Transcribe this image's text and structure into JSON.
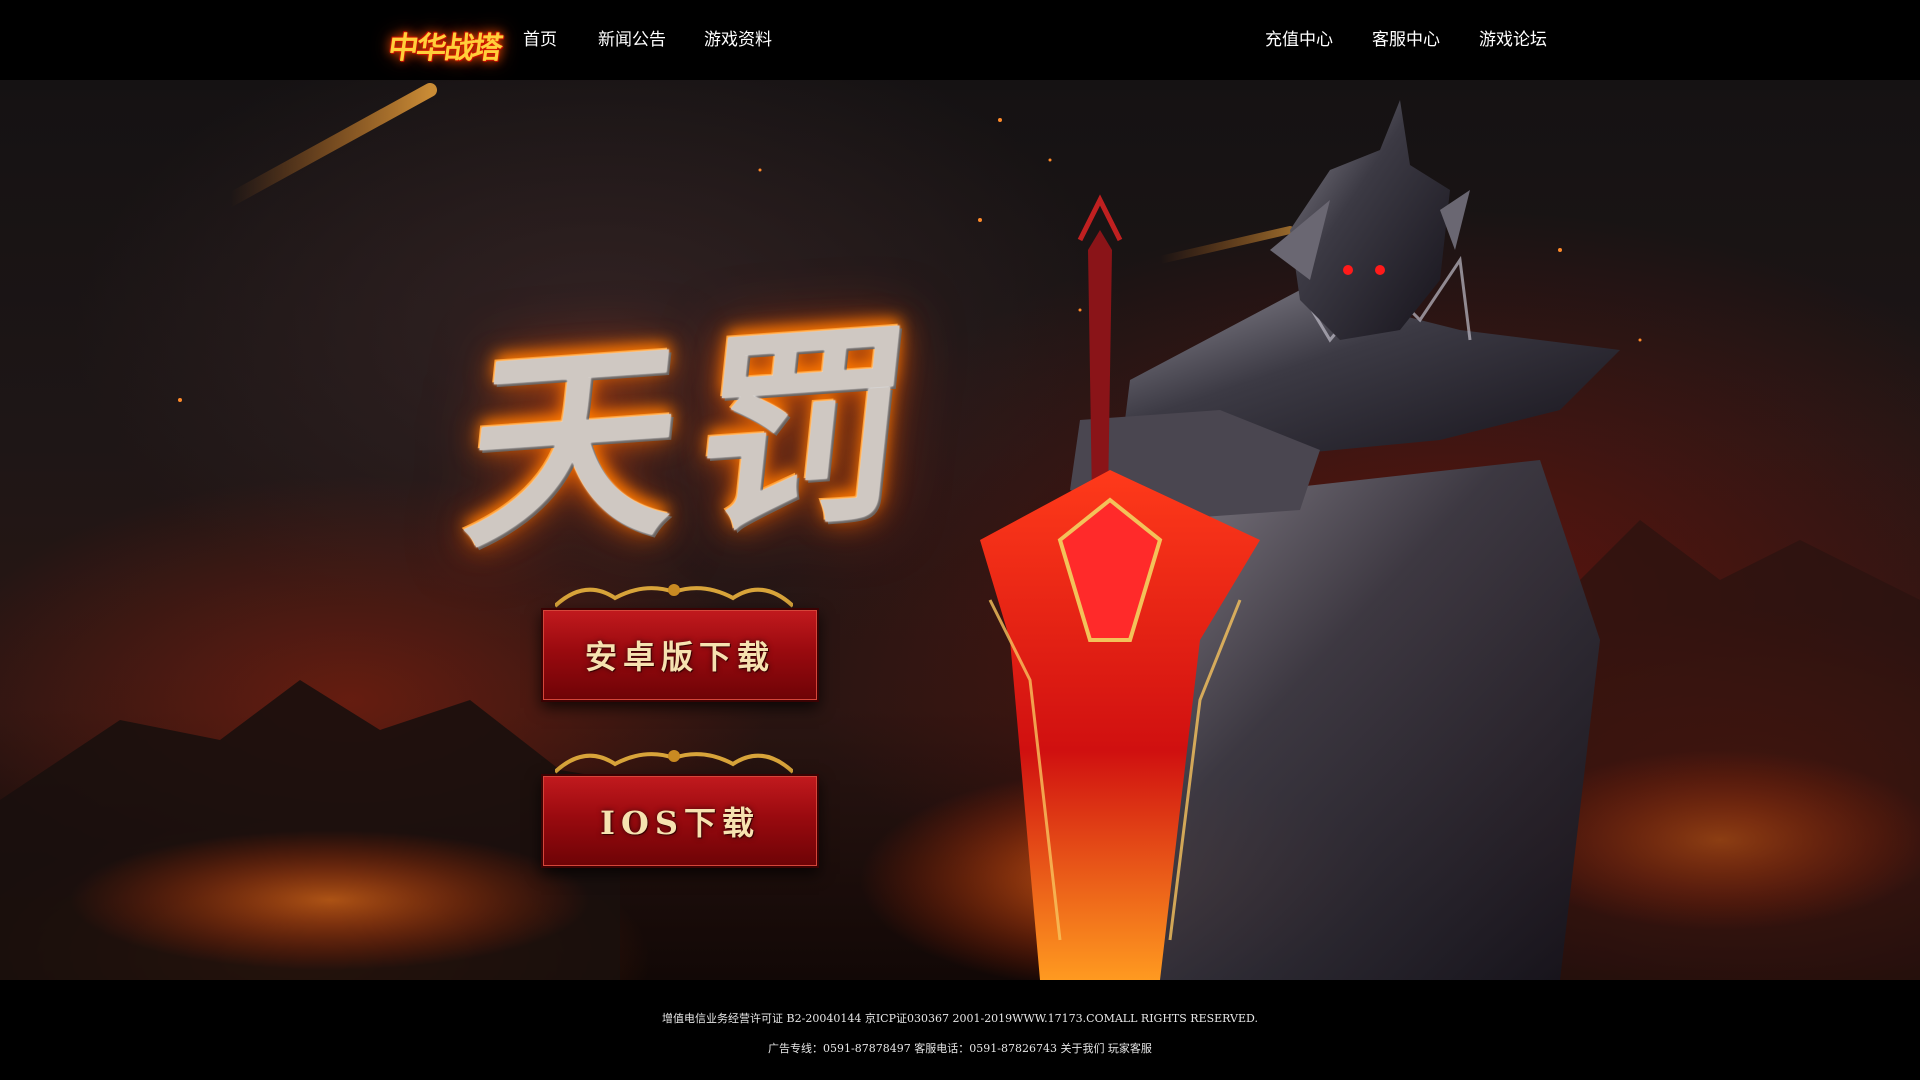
{
  "header": {
    "logo_text": "中华战塔",
    "nav_left": [
      "首页",
      "新闻公告",
      "游戏资料"
    ],
    "nav_right": [
      "充值中心",
      "客服中心",
      "游戏论坛"
    ]
  },
  "hero": {
    "title": "天罚",
    "android_button": "安卓版下载",
    "ios_button": "IOS下载"
  },
  "footer": {
    "line1": "增值电信业务经营许可证 B2-20040144 京ICP证030367  2001-2019WWW.17173.COMALL RIGHTS RESERVED.",
    "line2": "广告专线：0591-87878497 客服电话：0591-87826743 关于我们 玩家客服"
  },
  "colors": {
    "accent_red": "#9a0a0f",
    "button_text": "#f6e2b0",
    "logo_gold": "#ffcf3a"
  }
}
